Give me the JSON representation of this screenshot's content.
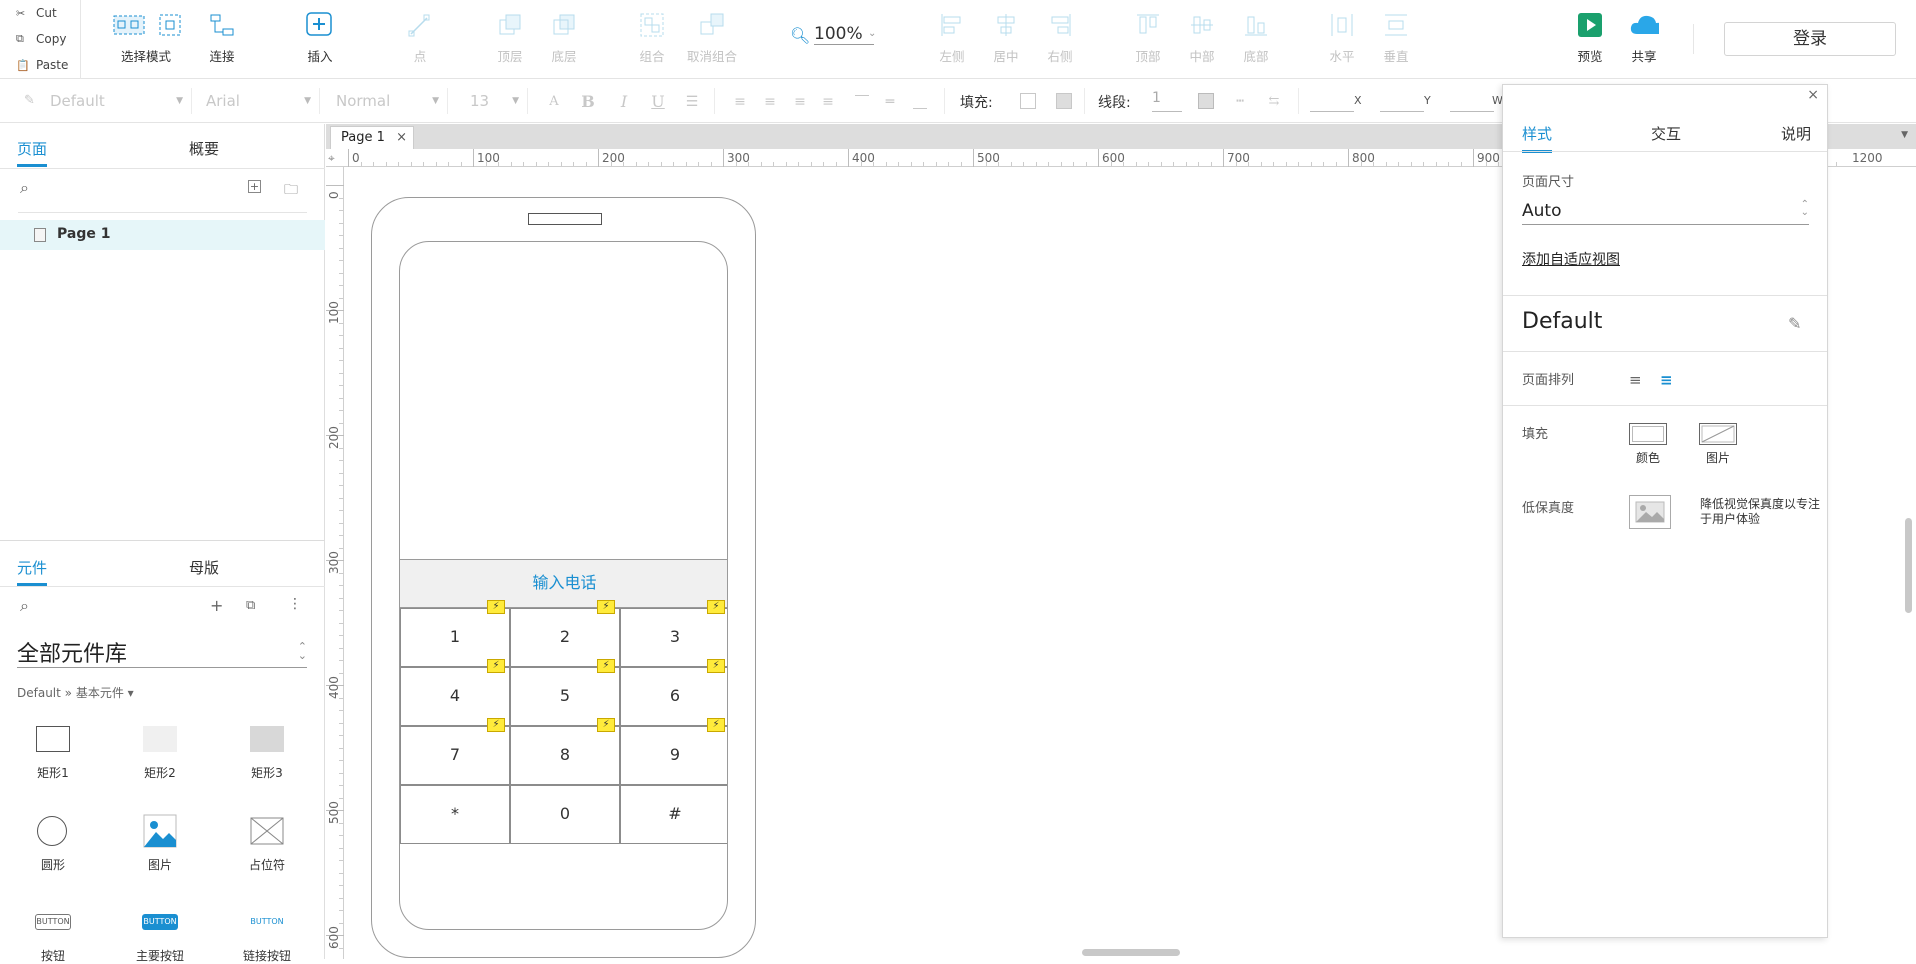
{
  "clipboard": {
    "cut": "Cut",
    "copy": "Copy",
    "paste": "Paste"
  },
  "toolbar": {
    "select_mode": "选择模式",
    "connect": "连接",
    "insert": "插入",
    "point": "点",
    "top_layer": "顶层",
    "bottom_layer": "底层",
    "group": "组合",
    "ungroup": "取消组合",
    "zoom": "100%",
    "align_left": "左侧",
    "align_center": "居中",
    "align_right": "右侧",
    "align_top": "顶部",
    "align_middle": "中部",
    "align_bottom": "底部",
    "distribute_h": "水平",
    "distribute_v": "垂直",
    "preview": "预览",
    "share": "共享",
    "login": "登录"
  },
  "format": {
    "style": "Default",
    "font": "Arial",
    "weight": "Normal",
    "size": "13",
    "fill_label": "填充:",
    "stroke_label": "线段:",
    "stroke_value": "1",
    "x_label": "X",
    "y_label": "Y",
    "w_label": "W"
  },
  "left_panel": {
    "tabs": [
      "页面",
      "概要"
    ],
    "page_item": "Page 1",
    "widgets_tabs": [
      "元件",
      "母版"
    ],
    "library": "全部元件库",
    "breadcrumb": "Default » 基本元件 ▾",
    "widgets": [
      "矩形1",
      "矩形2",
      "矩形3",
      "圆形",
      "图片",
      "占位符",
      "按钮",
      "主要按钮",
      "链接按钮"
    ],
    "button_glyph": "BUTTON"
  },
  "canvas": {
    "tab": "Page 1",
    "h_ruler": [
      "0",
      "100",
      "200",
      "300",
      "400",
      "500",
      "600",
      "700",
      "800",
      "900",
      "1200"
    ],
    "v_ruler": [
      "0",
      "100",
      "200",
      "300",
      "400",
      "500",
      "600"
    ],
    "phone": {
      "input_label": "输入电话",
      "keys": [
        "1",
        "2",
        "3",
        "4",
        "5",
        "6",
        "7",
        "8",
        "9",
        "*",
        "0",
        "#"
      ]
    }
  },
  "inspector": {
    "tabs": [
      "样式",
      "交互",
      "说明"
    ],
    "page_size_label": "页面尺寸",
    "page_size_value": "Auto",
    "adaptive_link": "添加自适应视图",
    "style_name": "Default",
    "page_align_label": "页面排列",
    "fill_label": "填充",
    "fill_color": "颜色",
    "fill_image": "图片",
    "low_fidelity_label": "低保真度",
    "low_fidelity_desc": "降低视觉保真度以专注于用户体验"
  },
  "colors": {
    "accent": "#1a8fd1",
    "preview_green": "#1aa06d",
    "share_blue": "#2aa7e8",
    "bolt_yellow": "#ffeb3b"
  }
}
